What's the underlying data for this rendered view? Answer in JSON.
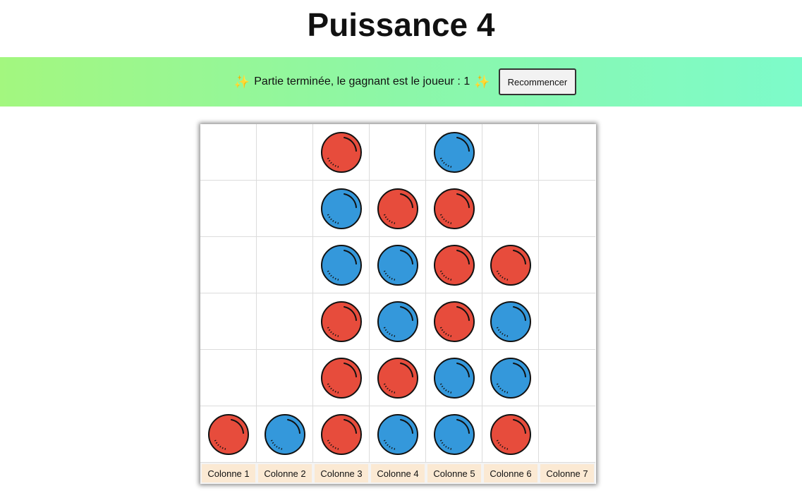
{
  "page": {
    "title": "Puissance 4"
  },
  "banner": {
    "sparkle_left": "✨",
    "message": "Partie terminée, le gagnant est le joueur : 1",
    "sparkle_right": "✨",
    "restart_label": "Recommencer"
  },
  "colors": {
    "player1": "#e74c3c",
    "player2": "#3498db",
    "outline": "#111111"
  },
  "board": {
    "rows": [
      [
        0,
        0,
        1,
        0,
        2,
        0,
        0
      ],
      [
        0,
        0,
        2,
        1,
        1,
        0,
        0
      ],
      [
        0,
        0,
        2,
        2,
        1,
        1,
        0
      ],
      [
        0,
        0,
        1,
        2,
        1,
        2,
        0
      ],
      [
        0,
        0,
        1,
        1,
        2,
        2,
        0
      ],
      [
        1,
        2,
        1,
        2,
        2,
        1,
        0
      ]
    ],
    "columns": [
      "Colonne 1",
      "Colonne 2",
      "Colonne 3",
      "Colonne 4",
      "Colonne 5",
      "Colonne 6",
      "Colonne 7"
    ]
  }
}
